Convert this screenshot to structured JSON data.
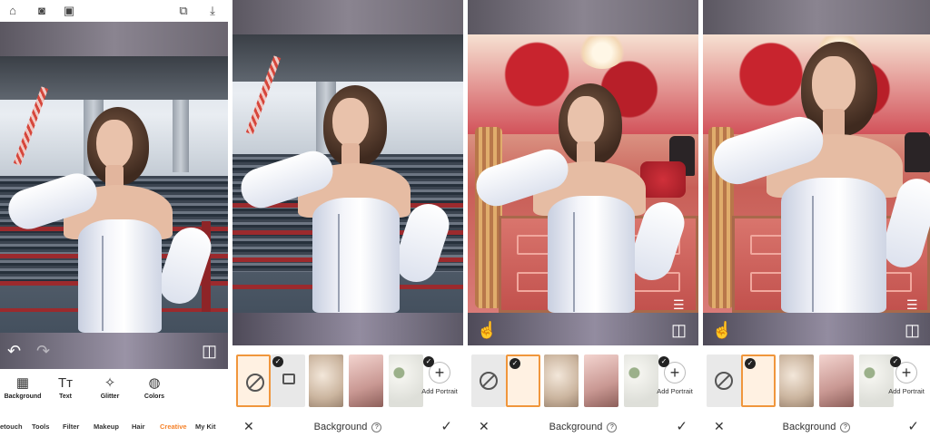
{
  "panel1": {
    "top_icons": [
      "home-icon",
      "camera-icon",
      "gallery-icon",
      "edit-history-icon",
      "download-icon"
    ],
    "tools": [
      {
        "label": "Background",
        "icon": "background-icon"
      },
      {
        "label": "Text",
        "icon": "text-icon"
      },
      {
        "label": "Glitter",
        "icon": "glitter-icon"
      },
      {
        "label": "Colors",
        "icon": "colors-icon"
      }
    ],
    "categories": [
      "etouch",
      "Tools",
      "Filter",
      "Makeup",
      "Hair",
      "Creative",
      "My Kit"
    ],
    "active_category": "Creative",
    "accent_color": "#f5822a"
  },
  "editor": {
    "title": "Background",
    "add_portrait_label": "Add Portrait",
    "help_glyph": "?"
  },
  "icons": {
    "undo": "↶",
    "redo": "↷",
    "compare": "◫",
    "adjust": "☰",
    "hand": "☝",
    "close": "✕",
    "confirm": "✓",
    "plus": "+"
  }
}
